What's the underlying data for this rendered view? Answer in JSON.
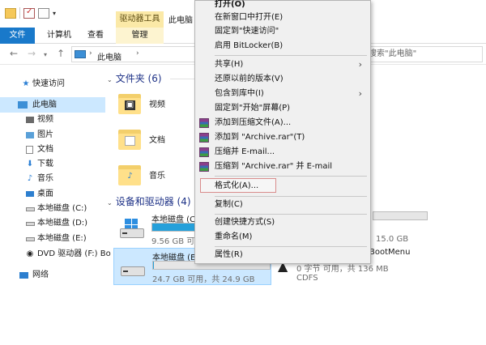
{
  "titlebar": {
    "context_tab": "驱动器工具",
    "window_title": "此电脑"
  },
  "ribbon": {
    "tabs": [
      {
        "label": "文件"
      },
      {
        "label": "计算机"
      },
      {
        "label": "查看"
      },
      {
        "label": "管理"
      }
    ]
  },
  "address": {
    "breadcrumb": "此电脑",
    "search_placeholder": "搜索\"此电脑\""
  },
  "navpane": {
    "items": [
      {
        "label": "快速访问",
        "icon": "star-icon"
      },
      {
        "label": "此电脑",
        "icon": "computer-icon"
      },
      {
        "label": "视频",
        "icon": "video-icon"
      },
      {
        "label": "图片",
        "icon": "picture-icon"
      },
      {
        "label": "文档",
        "icon": "document-icon"
      },
      {
        "label": "下载",
        "icon": "download-icon"
      },
      {
        "label": "音乐",
        "icon": "music-icon"
      },
      {
        "label": "桌面",
        "icon": "desktop-icon"
      },
      {
        "label": "本地磁盘 (C:)",
        "icon": "drive-icon"
      },
      {
        "label": "本地磁盘 (D:)",
        "icon": "drive-icon"
      },
      {
        "label": "本地磁盘 (E:)",
        "icon": "drive-icon"
      },
      {
        "label": "DVD 驱动器 (F:) Bo",
        "icon": "dvd-icon"
      },
      {
        "label": "网络",
        "icon": "network-icon"
      }
    ]
  },
  "content": {
    "folders_header": "文件夹 (6)",
    "folders": [
      {
        "label": "视频"
      },
      {
        "label": "文档"
      },
      {
        "label": "音乐"
      }
    ],
    "devices_header": "设备和驱动器 (4)",
    "drives": [
      {
        "name": "本地磁盘 (C:)",
        "free": "9.56 GB 可用",
        "used_fraction": 0.38
      },
      {
        "name": "本地磁盘 (E:)",
        "free": "24.7 GB 可用，共 24.9 GB",
        "used_fraction": 0.01
      }
    ],
    "right_fragments": {
      "d_size": "15.0 GB",
      "dvd_name": "BootMenu",
      "dvd_free": "0 字节 可用，共 136 MB",
      "dvd_fs": "CDFS"
    }
  },
  "context_menu": {
    "items": [
      {
        "label": "打开(O)"
      },
      {
        "label": "在新窗口中打开(E)"
      },
      {
        "label": "固定到\"快速访问\""
      },
      {
        "label": "启用 BitLocker(B)"
      },
      {
        "label": "共享(H)"
      },
      {
        "label": "还原以前的版本(V)"
      },
      {
        "label": "包含到库中(I)"
      },
      {
        "label": "固定到\"开始\"屏幕(P)"
      },
      {
        "label": "添加到压缩文件(A)..."
      },
      {
        "label": "添加到 \"Archive.rar\"(T)"
      },
      {
        "label": "压缩并 E-mail..."
      },
      {
        "label": "压缩到 \"Archive.rar\" 并 E-mail"
      },
      {
        "label": "格式化(A)..."
      },
      {
        "label": "复制(C)"
      },
      {
        "label": "创建快捷方式(S)"
      },
      {
        "label": "重命名(M)"
      },
      {
        "label": "属性(R)"
      }
    ]
  }
}
